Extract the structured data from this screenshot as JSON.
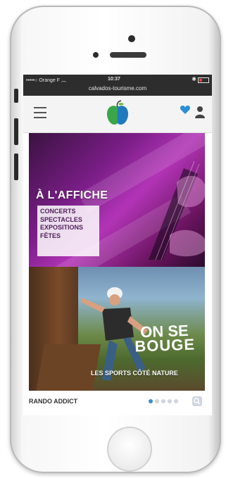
{
  "statusbar": {
    "carrier": "•••••○ Orange F",
    "time": "10:37",
    "url": "calvados-tourisme.com",
    "wifi_icon": "wifi-icon",
    "bluetooth_icon": "bluetooth-icon",
    "battery_icon": "battery-icon"
  },
  "navbar": {
    "menu_icon": "hamburger-menu-icon",
    "logo": "apple-logo",
    "favorites_icon": "heart-icon",
    "user_icon": "user-icon"
  },
  "banner1": {
    "title": "À L'AFFICHE",
    "items": [
      "CONCERTS",
      "SPECTACLES",
      "EXPOSITIONS",
      "FÊTES"
    ]
  },
  "banner2": {
    "line1": "ON SE",
    "line2": "BOUGE",
    "subtitle": "LES SPORTS CÔTÉ NATURE"
  },
  "bottombar": {
    "label": "RANDO ADDICT",
    "dots": 5,
    "active_dot": 1,
    "search_icon": "search-icon"
  },
  "colors": {
    "logo_green": "#3aa648",
    "logo_blue": "#1f7ac0",
    "heart_blue": "#2b8fd6",
    "dot_active": "#3a8fd0"
  }
}
